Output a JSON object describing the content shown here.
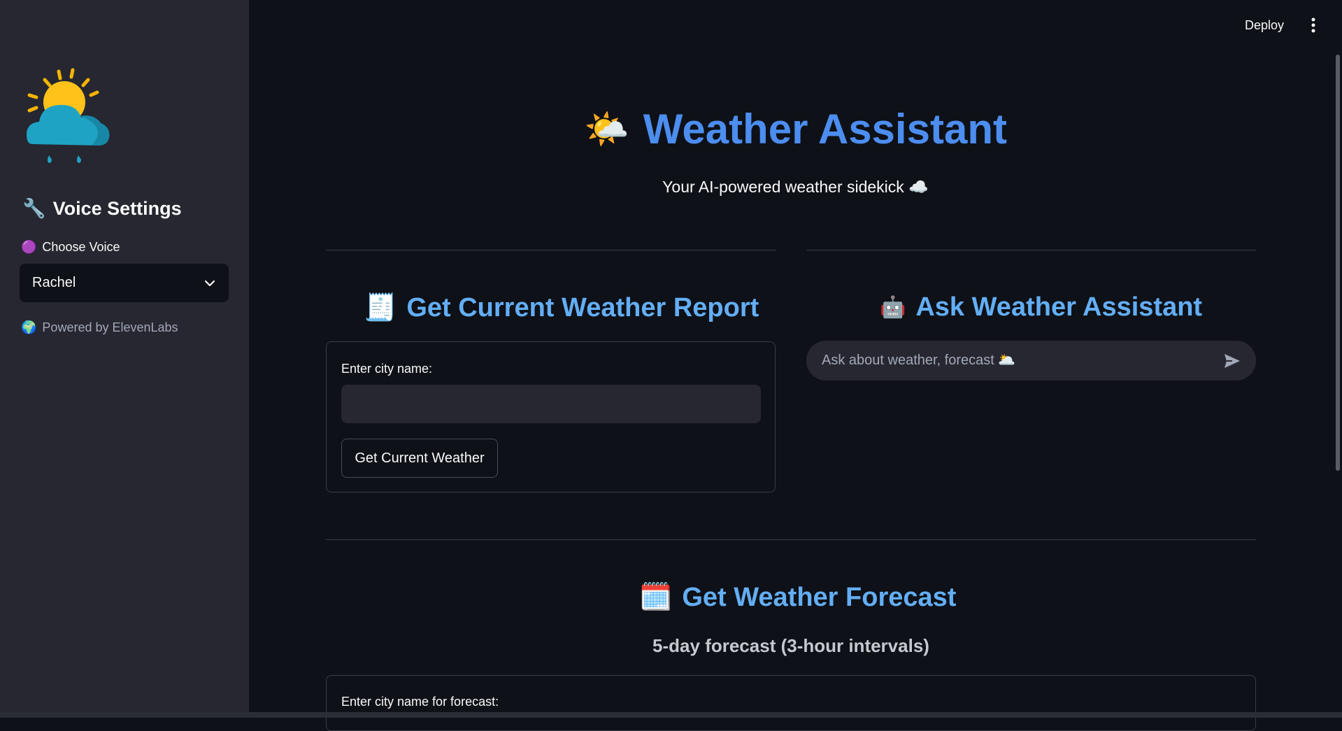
{
  "sidebar": {
    "heading": "Voice Settings",
    "choose_voice_label": "Choose Voice",
    "voice_selected": "Rachel",
    "caption": "Powered by ElevenLabs"
  },
  "topbar": {
    "deploy_label": "Deploy"
  },
  "header": {
    "title": "Weather Assistant",
    "subtitle": "Your AI-powered weather sidekick ☁️"
  },
  "current_weather": {
    "title": "Get Current Weather Report",
    "city_label": "Enter city name:",
    "city_value": "",
    "button_label": "Get Current Weather"
  },
  "assistant": {
    "title": "Ask Weather Assistant",
    "placeholder": "Ask about weather, forecast 🌥️"
  },
  "forecast": {
    "title": "Get Weather Forecast",
    "subtitle": "5-day forecast (3-hour intervals)",
    "city_label": "Enter city name for forecast:"
  },
  "colors": {
    "accent_title": "#4c8df0",
    "accent_section": "#63aef5",
    "background": "#0e1117",
    "sidebar": "#262730"
  }
}
